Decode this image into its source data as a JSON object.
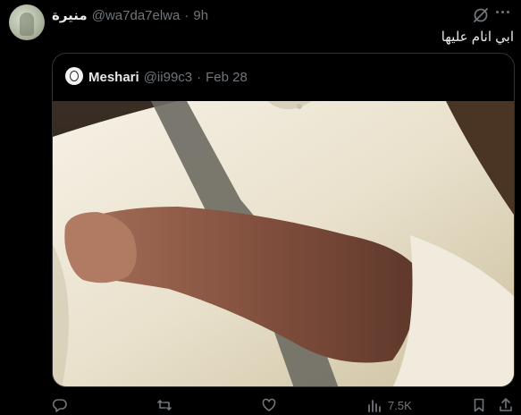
{
  "author": {
    "display_name": "منيرة",
    "handle": "@wa7da7elwa",
    "time": "9h"
  },
  "tweet_text": "ابي انام عليها",
  "quoted_tweet": {
    "display_name": "Meshari",
    "handle": "@ii99c3",
    "time": "Feb 28"
  },
  "actions": {
    "views_count": "7.5K"
  },
  "separator": "·",
  "icons": {
    "grok": "grok-icon",
    "more": "more-icon",
    "reply": "reply-icon",
    "retweet": "retweet-icon",
    "like": "like-icon",
    "views": "views-icon",
    "bookmark": "bookmark-icon",
    "share": "share-icon"
  },
  "colors": {
    "background": "#000000",
    "text": "#e7e9ea",
    "secondary": "#71767b",
    "border": "#2f3336"
  }
}
